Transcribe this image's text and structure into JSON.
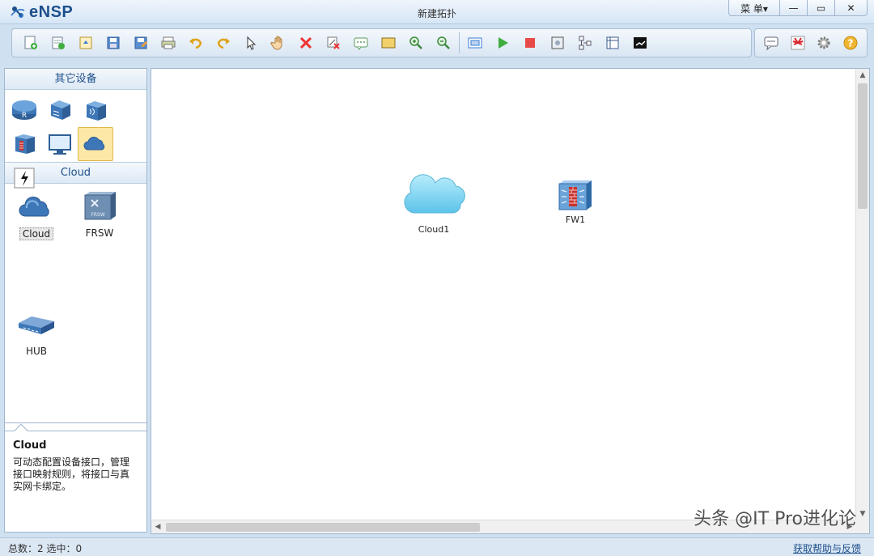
{
  "window": {
    "app_name": "eNSP",
    "title": "新建拓扑",
    "menu_label": "菜 单▾",
    "min_glyph": "—",
    "max_glyph": "▭",
    "close_glyph": "✕"
  },
  "toolbar": {
    "buttons": [
      "new-topology-icon",
      "new-lab-icon",
      "open-icon",
      "save-icon",
      "save-as-icon",
      "print-icon",
      "undo-icon",
      "redo-icon",
      "select-pointer-icon",
      "hand-pan-icon",
      "delete-icon",
      "delete-link-icon",
      "text-annotation-icon",
      "rectangle-icon",
      "zoom-in-icon",
      "zoom-out-icon",
      "fit-view-icon",
      "start-device-icon",
      "stop-device-icon",
      "capture-icon",
      "topology-icon",
      "grid-icon",
      "console-icon"
    ],
    "right_buttons": [
      "chat-icon",
      "huawei-icon",
      "settings-icon",
      "help-icon"
    ]
  },
  "left_panel": {
    "category_header": "其它设备",
    "devices": [
      "router-icon",
      "switch-icon",
      "wireless-icon",
      "firewall-icon",
      "pc-icon",
      "cloud-icon",
      "other-icon"
    ],
    "sub_header": "Cloud",
    "items": [
      {
        "label": "Cloud",
        "icon": "cloud-icon",
        "selected": true
      },
      {
        "label": "FRSW",
        "icon": "frsw-icon",
        "selected": false
      },
      {
        "label": "HUB",
        "icon": "hub-icon",
        "selected": false
      }
    ],
    "description": {
      "title": "Cloud",
      "text": "可动态配置设备接口，管理接口映射规则，将接口与真实网卡绑定。"
    }
  },
  "canvas": {
    "nodes": [
      {
        "label": "Cloud1",
        "type": "cloud"
      },
      {
        "label": "FW1",
        "type": "firewall"
      }
    ]
  },
  "status": {
    "left": "总数：2 选中：0",
    "right": "获取帮助与反馈"
  },
  "watermark": "头条 @IT Pro进化论",
  "colors": {
    "accent": "#1d4f8c",
    "cloud": "#7fd3f0",
    "firewall": "#6aa3d8"
  }
}
